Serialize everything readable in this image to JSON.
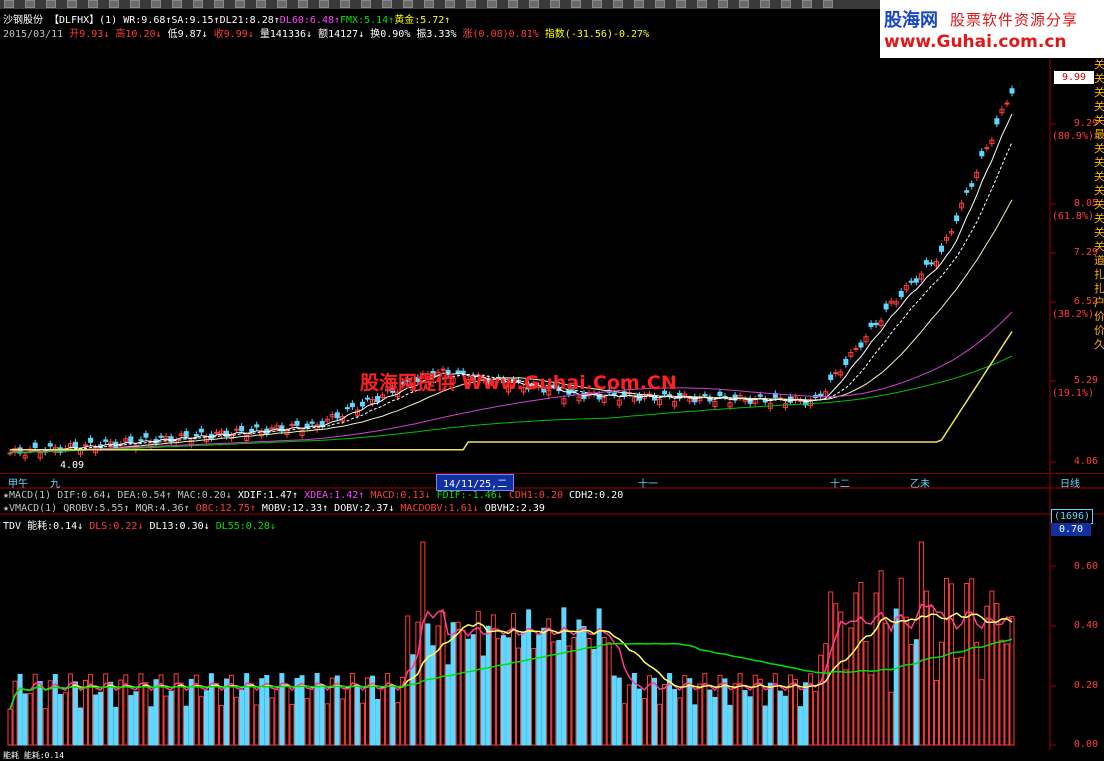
{
  "stock": {
    "name": "沙钢股份",
    "formula": "【DLFHX】(1)",
    "indicators": [
      {
        "label": "WR:9.68",
        "arrow": "↑",
        "color": "#ffffff"
      },
      {
        "label": "SA:9.15",
        "arrow": "↑",
        "color": "#ffffff"
      },
      {
        "label": "DL21:8.28",
        "arrow": "↑",
        "color": "#ffffff"
      },
      {
        "label": "DL60:6.48",
        "arrow": "↑",
        "color": "#ff44ff"
      },
      {
        "label": "FMX:5.14",
        "arrow": "↑",
        "color": "#00e000"
      },
      {
        "label": "黄金:5.72",
        "arrow": "↑",
        "color": "#ffff00"
      }
    ]
  },
  "quote": {
    "date": "2015/03/11",
    "open": "开9.93",
    "high": "高10.20",
    "low": "低9.87",
    "close": "收9.99",
    "volume": "量141336",
    "amount": "额14127",
    "turnover": "换0.90%",
    "amplitude": "振3.33%",
    "change": "涨(0.08)0.81%",
    "index": "指数(-31.56)-0.27%"
  },
  "logo": {
    "brand": "股海网",
    "slogan": "股票软件资源分享",
    "url": "www.Guhai.com.cn"
  },
  "watermark": "股海网提供 Www.Guhai.Com.CN",
  "price_axis": {
    "current": "9.99",
    "labels": [
      "9.29",
      "8.05",
      "7.29",
      "6.52",
      "5.29",
      "4.06"
    ],
    "percents": [
      "(80.9%)",
      "(61.8%)",
      "(38.2%)",
      "(19.1%)"
    ],
    "low_marker": "4.09"
  },
  "datebar": {
    "items": [
      "甲午",
      "九",
      "14/11/25,二",
      "十一",
      "十二",
      "乙未"
    ],
    "period": "日线"
  },
  "macd_line": {
    "star": "★",
    "items": [
      {
        "text": "MACD(1)",
        "color": "#c0c0c0"
      },
      {
        "text": "DIF:0.64↓",
        "color": "#c0c0c0"
      },
      {
        "text": "DEA:0.54↑",
        "color": "#c0c0c0"
      },
      {
        "text": "MAC:0.20↓",
        "color": "#c0c0c0"
      },
      {
        "text": "XDIF:1.47↑",
        "color": "#ffffff"
      },
      {
        "text": "XDEA:1.42↑",
        "color": "#ff44ff"
      },
      {
        "text": "MACD:0.13↓",
        "color": "#ff3c3c"
      },
      {
        "text": "FDIF:-1.46↓",
        "color": "#00e000"
      },
      {
        "text": "CDH1:0.20",
        "color": "#ff3c3c"
      },
      {
        "text": "CDH2:0.20",
        "color": "#ffffff"
      }
    ]
  },
  "vmacd_line": {
    "star": "★",
    "items": [
      {
        "text": "VMACD(1)",
        "color": "#c0c0c0"
      },
      {
        "text": "QROBV:5.55↑",
        "color": "#c0c0c0"
      },
      {
        "text": "MQR:4.36↑",
        "color": "#c0c0c0"
      },
      {
        "text": "OBC:12.75↑",
        "color": "#ff3c3c"
      },
      {
        "text": "MOBV:12.33↑",
        "color": "#ffffff"
      },
      {
        "text": "DOBV:2.37↓",
        "color": "#ffffff"
      },
      {
        "text": "MACDOBV:1.61↓",
        "color": "#ff3c3c"
      },
      {
        "text": "OBVH2:2.39",
        "color": "#ffffff"
      }
    ]
  },
  "tdv_line": {
    "items": [
      {
        "text": "TDV 能耗:0.14↓",
        "color": "#ffffff"
      },
      {
        "text": "DLS:0.22↓",
        "color": "#ff3c3c"
      },
      {
        "text": "DL13:0.30↓",
        "color": "#ffffff"
      },
      {
        "text": "DL55:0.28↓",
        "color": "#00e000"
      }
    ]
  },
  "sub_axis": {
    "badge_top": "(1696)",
    "badge_val": "0.70",
    "labels": [
      "0.60",
      "0.40",
      "0.20",
      "0.00"
    ]
  },
  "bottom_line": "能耗  能耗:0.14",
  "colors": {
    "up": "#ff3c3c",
    "down": "#5fd7ff",
    "ma_white": "#ffffff",
    "ma_magenta": "#d040d0",
    "ma_green": "#00c000",
    "ma_yellow": "#f0e060"
  }
}
